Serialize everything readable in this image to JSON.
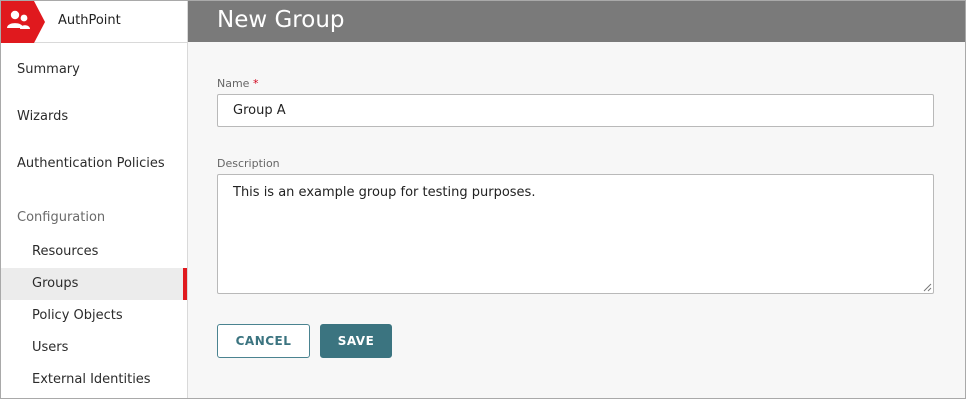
{
  "app": {
    "name": "AuthPoint",
    "logo_icon": "users-icon",
    "brand_color": "#e0191e"
  },
  "sidebar": {
    "top_items": [
      {
        "label": "Summary"
      },
      {
        "label": "Wizards"
      },
      {
        "label": "Authentication Policies"
      }
    ],
    "section_label": "Configuration",
    "sub_items": [
      {
        "label": "Resources",
        "active": false
      },
      {
        "label": "Groups",
        "active": true
      },
      {
        "label": "Policy Objects",
        "active": false
      },
      {
        "label": "Users",
        "active": false
      },
      {
        "label": "External Identities",
        "active": false
      }
    ]
  },
  "page": {
    "title": "New Group"
  },
  "form": {
    "name": {
      "label": "Name",
      "required_marker": "*",
      "value": "Group A"
    },
    "description": {
      "label": "Description",
      "value": "This is an example group for testing purposes."
    },
    "cancel_label": "CANCEL",
    "save_label": "SAVE"
  }
}
